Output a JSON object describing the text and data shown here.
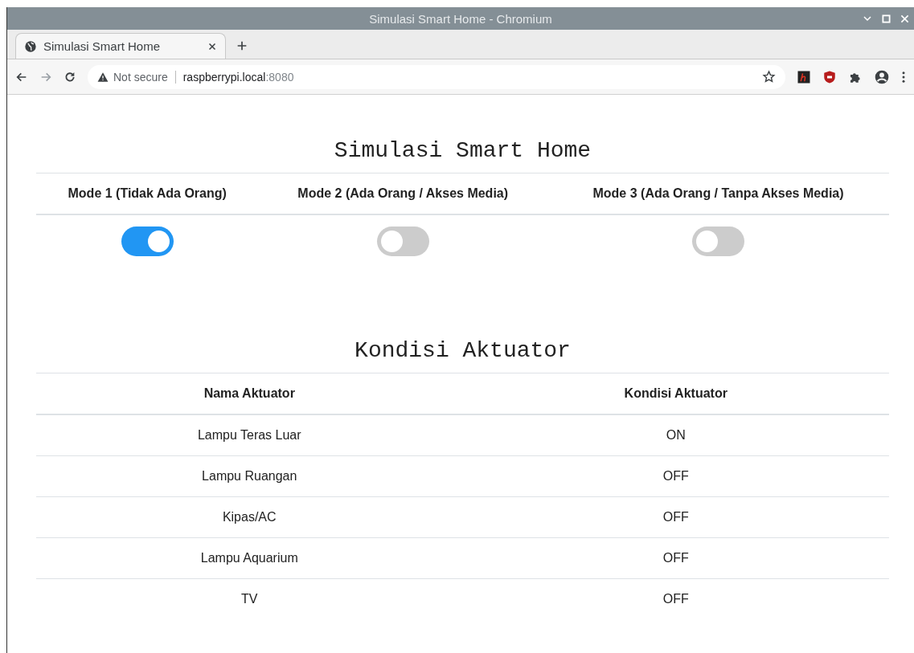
{
  "window": {
    "title": "Simulasi Smart Home - Chromium"
  },
  "tabs": [
    {
      "label": "Simulasi Smart Home",
      "selected": true
    }
  ],
  "address_bar": {
    "security": "Not secure",
    "host": "raspberrypi.local",
    "port": ":8080"
  },
  "page": {
    "title": "Simulasi Smart Home",
    "modes": [
      {
        "label": "Mode 1 (Tidak Ada Orang)",
        "on": true
      },
      {
        "label": "Mode 2 (Ada Orang / Akses Media)",
        "on": false
      },
      {
        "label": "Mode 3 (Ada Orang / Tanpa Akses Media)",
        "on": false
      }
    ],
    "actuator_title": "Kondisi Aktuator",
    "table": {
      "columns": [
        "Nama Aktuator",
        "Kondisi Aktuator"
      ],
      "rows": [
        [
          "Lampu Teras Luar",
          "ON"
        ],
        [
          "Lampu Ruangan",
          "OFF"
        ],
        [
          "Kipas/AC",
          "OFF"
        ],
        [
          "Lampu Aquarium",
          "OFF"
        ],
        [
          "TV",
          "OFF"
        ]
      ]
    }
  }
}
